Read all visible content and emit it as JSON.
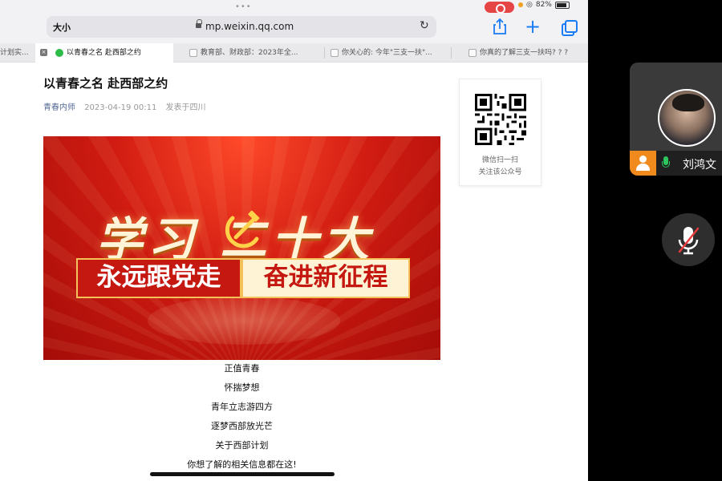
{
  "status_bar": {
    "battery": "82%"
  },
  "browser": {
    "text_size_label": "大小",
    "url": "mp.weixin.qq.com",
    "tabs": [
      {
        "label": "计划实..."
      },
      {
        "label": "以青春之名 赴西部之约"
      },
      {
        "label": "教育部、财政部：2023年全..."
      },
      {
        "label": "你关心的: 今年\"三支一扶\"..."
      },
      {
        "label": "你真的了解三支一扶吗? ? ?"
      }
    ]
  },
  "article": {
    "title": "以青春之名 赴西部之约",
    "author": "青春内师",
    "date": "2023-04-19 00:11",
    "location": "发表于四川",
    "banner": {
      "big_text": "学习 二十大",
      "sub_left": "永远跟党走",
      "sub_right": "奋进新征程"
    },
    "body_lines": [
      "正值青春",
      "怀揣梦想",
      "青年立志游四方",
      "逐梦西部放光芒",
      "关于西部计划",
      "你想了解的相关信息都在这!"
    ]
  },
  "qr_card": {
    "line1": "微信扫一扫",
    "line2": "关注该公众号"
  },
  "meeting": {
    "participant_name": "刘鸿文"
  },
  "colors": {
    "accent_blue": "#1a7cf5",
    "author_link": "#576b95",
    "banner_red": "#d11c12",
    "host_orange": "#f08a1c",
    "mic_green": "#2dc55e"
  }
}
